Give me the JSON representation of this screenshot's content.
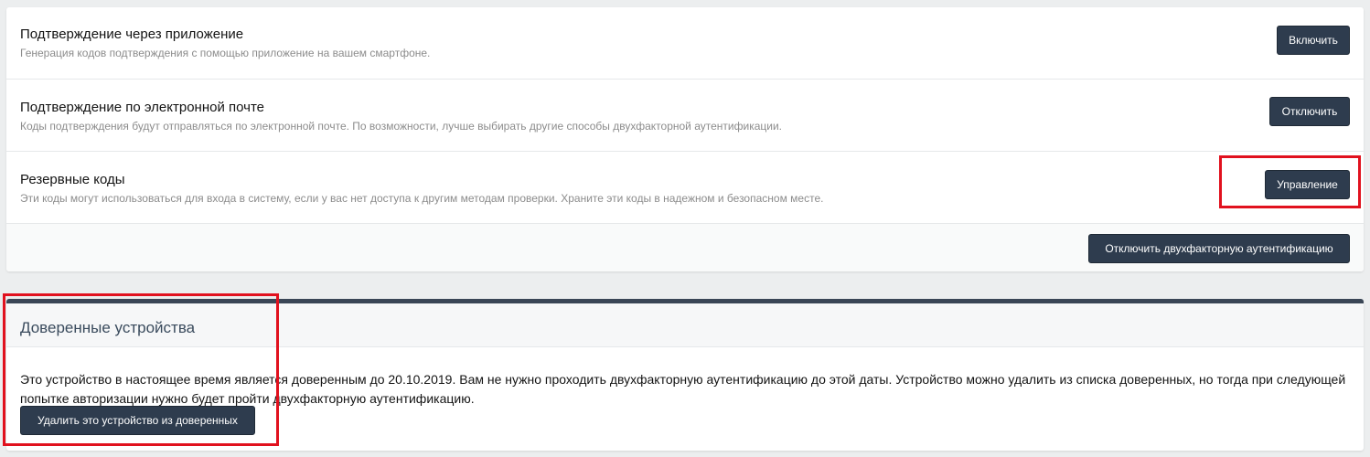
{
  "methods": [
    {
      "title": "Подтверждение через приложение",
      "description": "Генерация кодов подтверждения с помощью приложение на вашем смартфоне.",
      "button": "Включить"
    },
    {
      "title": "Подтверждение по электронной почте",
      "description": "Коды подтверждения будут отправляться по электронной почте. По возможности, лучше выбирать другие способы двухфакторной аутентификации.",
      "button": "Отключить"
    },
    {
      "title": "Резервные коды",
      "description": "Эти коды могут использоваться для входа в систему, если у вас нет доступа к другим методам проверки. Храните эти коды в надежном и безопасном месте.",
      "button": "Управление"
    }
  ],
  "footer": {
    "disable_2fa_button": "Отключить двухфакторную аутентификацию"
  },
  "trusted_devices": {
    "title": "Доверенные устройства",
    "text": "Это устройство в настоящее время является доверенным до 20.10.2019. Вам не нужно проходить двухфакторную аутентификацию до этой даты. Устройство можно удалить из списка доверенных, но тогда при следующей попытке авторизации нужно будет пройти двухфакторную аутентификацию.",
    "remove_button": "Удалить это устройство из доверенных"
  },
  "colors": {
    "button_bg": "#2e3c4e",
    "highlight": "#e1111e",
    "panel_accent": "#3a4656"
  }
}
